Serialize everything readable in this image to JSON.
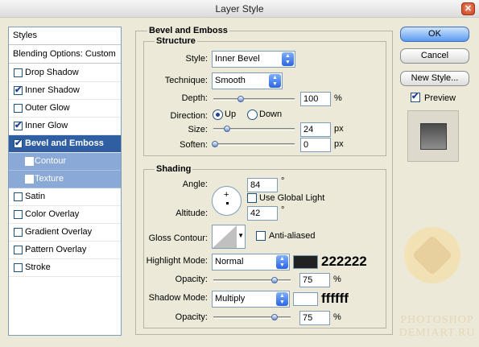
{
  "window": {
    "title": "Layer Style",
    "close_glyph": "✕"
  },
  "styles_list": {
    "header": "Styles",
    "blending": "Blending Options: Custom",
    "items": [
      {
        "label": "Drop Shadow",
        "checked": false
      },
      {
        "label": "Inner Shadow",
        "checked": true
      },
      {
        "label": "Outer Glow",
        "checked": false
      },
      {
        "label": "Inner Glow",
        "checked": true
      },
      {
        "label": "Bevel and Emboss",
        "checked": true,
        "active": true
      },
      {
        "label": "Contour",
        "checked": false,
        "sub": true
      },
      {
        "label": "Texture",
        "checked": false,
        "sub": true
      },
      {
        "label": "Satin",
        "checked": false
      },
      {
        "label": "Color Overlay",
        "checked": false
      },
      {
        "label": "Gradient Overlay",
        "checked": false
      },
      {
        "label": "Pattern Overlay",
        "checked": false
      },
      {
        "label": "Stroke",
        "checked": false
      }
    ]
  },
  "bevel": {
    "title": "Bevel and Emboss",
    "structure": {
      "title": "Structure",
      "style_label": "Style:",
      "style_value": "Inner Bevel",
      "technique_label": "Technique:",
      "technique_value": "Smooth",
      "depth_label": "Depth:",
      "depth_value": "100",
      "depth_unit": "%",
      "direction_label": "Direction:",
      "dir_up": "Up",
      "dir_down": "Down",
      "size_label": "Size:",
      "size_value": "24",
      "size_unit": "px",
      "soften_label": "Soften:",
      "soften_value": "0",
      "soften_unit": "px"
    },
    "shading": {
      "title": "Shading",
      "angle_label": "Angle:",
      "angle_value": "84",
      "angle_unit": "°",
      "global_light_label": "Use Global Light",
      "altitude_label": "Altitude:",
      "altitude_value": "42",
      "altitude_unit": "°",
      "gloss_label": "Gloss Contour:",
      "anti_aliased_label": "Anti-aliased",
      "highlight_mode_label": "Highlight Mode:",
      "highlight_mode_value": "Normal",
      "highlight_color": "#222222",
      "highlight_hex": "222222",
      "highlight_opacity_label": "Opacity:",
      "highlight_opacity_value": "75",
      "highlight_opacity_unit": "%",
      "shadow_mode_label": "Shadow Mode:",
      "shadow_mode_value": "Multiply",
      "shadow_color": "#ffffff",
      "shadow_hex": "ffffff",
      "shadow_opacity_label": "Opacity:",
      "shadow_opacity_value": "75",
      "shadow_opacity_unit": "%"
    }
  },
  "buttons": {
    "ok": "OK",
    "cancel": "Cancel",
    "new_style": "New Style...",
    "preview_label": "Preview"
  },
  "watermark": {
    "line1": "PHOTOSHOP",
    "line2": "DEMIART.RU"
  }
}
